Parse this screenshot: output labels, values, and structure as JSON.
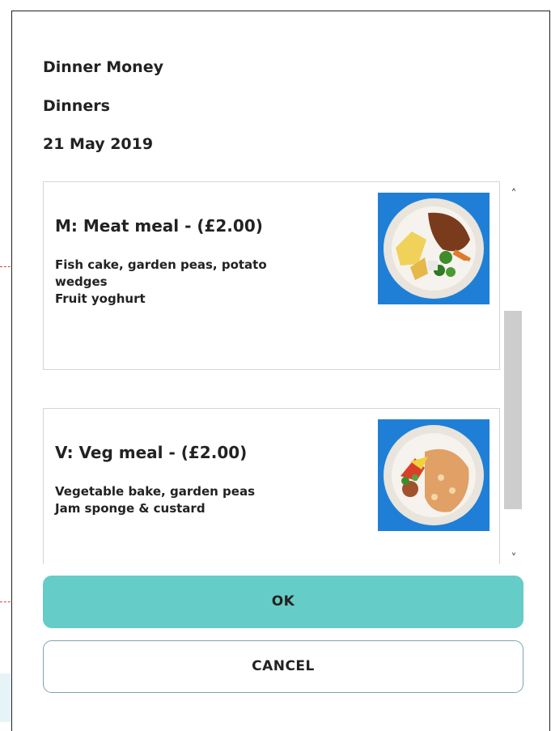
{
  "dialog": {
    "header_lines": [
      "Dinner Money",
      "Dinners",
      "21 May 2019"
    ]
  },
  "meals": [
    {
      "title": "M: Meat meal - (£2.00)",
      "description": "Fish cake, garden peas, potato\nwedges\nFruit yoghurt",
      "photo_icon": "meat-meal-plate-photo"
    },
    {
      "title": "V: Veg meal - (£2.00)",
      "description": "Vegetable bake, garden peas\nJam sponge & custard",
      "photo_icon": "veg-meal-plate-photo"
    }
  ],
  "scrollbar": {
    "up_glyph": "˄",
    "down_glyph": "˅"
  },
  "buttons": {
    "ok_label": "OK",
    "cancel_label": "CANCEL"
  },
  "colors": {
    "ok_button": "#66ccc8",
    "cancel_border": "#7fa3b0",
    "photo_background": "#1f7fd6",
    "annotation_line": "#d9453a"
  }
}
